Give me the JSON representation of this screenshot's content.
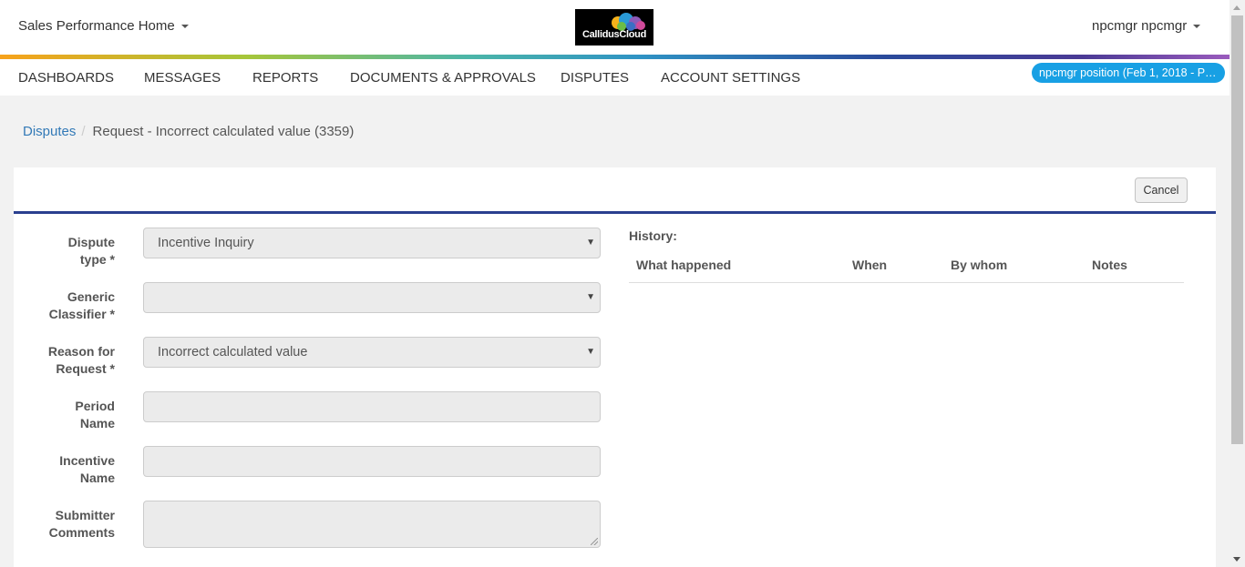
{
  "header": {
    "app_menu": "Sales Performance Home",
    "logo_text": "CallidusCloud",
    "user_menu": "npcmgr npcmgr"
  },
  "nav": {
    "items": [
      "DASHBOARDS",
      "MESSAGES",
      "REPORTS",
      "DOCUMENTS & APPROVALS",
      "DISPUTES",
      "ACCOUNT SETTINGS"
    ],
    "position_pill": "npcmgr position (Feb 1, 2018 - Pre..."
  },
  "breadcrumb": {
    "root": "Disputes",
    "separator": "/",
    "current": "Request - Incorrect calculated value (3359)"
  },
  "toolbar": {
    "cancel_label": "Cancel"
  },
  "form": {
    "fields": [
      {
        "label_line1": "Dispute",
        "label_line2": "type *",
        "value": "Incentive Inquiry",
        "type": "select"
      },
      {
        "label_line1": "Generic",
        "label_line2": "Classifier *",
        "value": "",
        "type": "select"
      },
      {
        "label_line1": "Reason for",
        "label_line2": "Request *",
        "value": "Incorrect calculated value",
        "type": "select"
      },
      {
        "label_line1": "Period",
        "label_line2": "Name",
        "value": "",
        "type": "text"
      },
      {
        "label_line1": "Incentive",
        "label_line2": "Name",
        "value": "",
        "type": "text"
      },
      {
        "label_line1": "Submitter",
        "label_line2": "Comments",
        "value": "",
        "type": "textarea"
      }
    ]
  },
  "history": {
    "title": "History:",
    "columns": [
      "What happened",
      "When",
      "By whom",
      "Notes"
    ],
    "rows": []
  },
  "icons": {
    "dropdown": "caret-down-icon",
    "select_arrow": "select-arrow-icon"
  },
  "colors": {
    "accent_link": "#337ab7",
    "pill": "#18a0e4",
    "panel_rule": "#2a3f8f"
  }
}
